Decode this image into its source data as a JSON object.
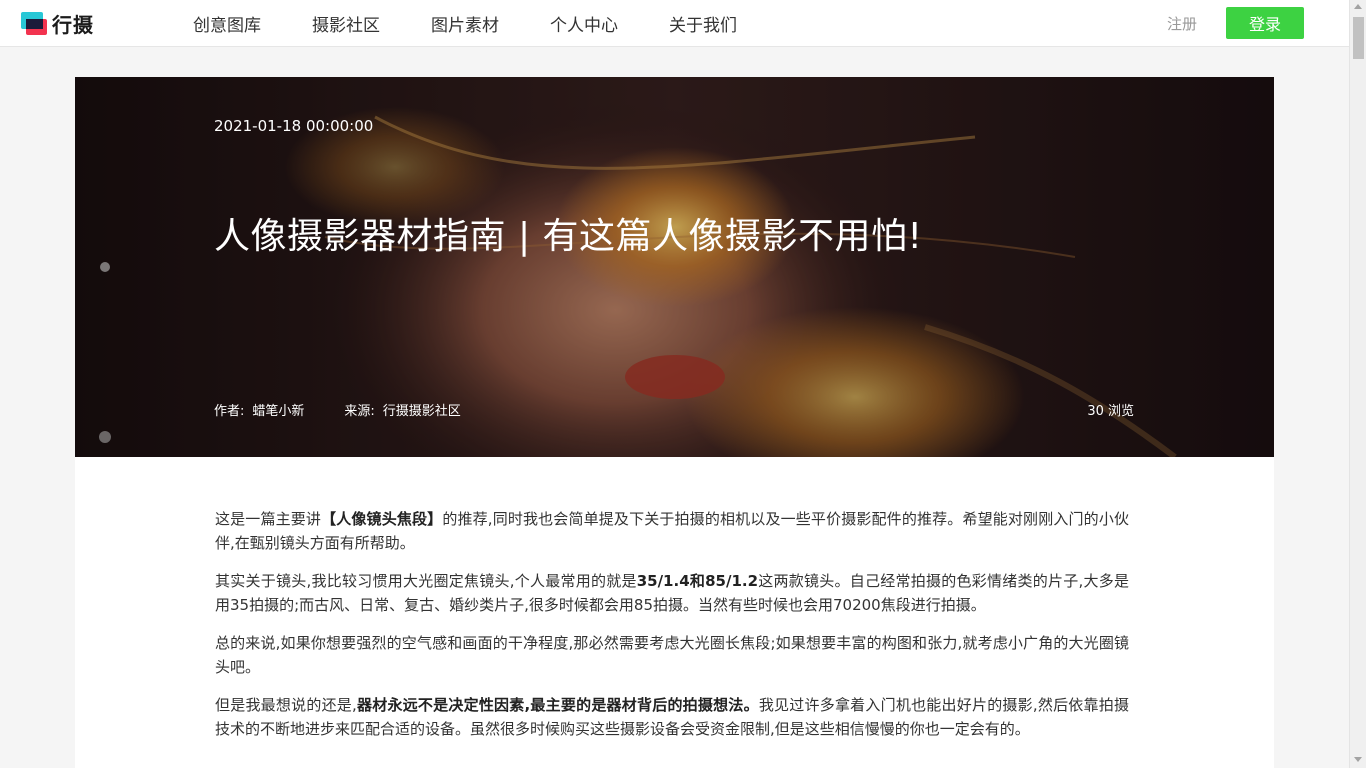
{
  "header": {
    "logo_text": "行摄",
    "nav": [
      "创意图库",
      "摄影社区",
      "图片素材",
      "个人中心",
      "关于我们"
    ],
    "register_label": "注册",
    "login_label": "登录",
    "accent_color": "#3dd242"
  },
  "hero": {
    "date": "2021-01-18 00:00:00",
    "title": "人像摄影器材指南 | 有这篇人像摄影不用怕!",
    "author_label": "作者:",
    "author": "蜡笔小新",
    "source_label": "来源:",
    "source": "行摄摄影社区",
    "views": "30 浏览"
  },
  "article": {
    "p1": {
      "a": "这是一篇主要讲",
      "b": "【人像镜头焦段】",
      "c": "的推荐,同时我也会简单提及下关于拍摄的相机以及一些平价摄影配件的推荐。希望能对刚刚入门的小伙伴,在甄别镜头方面有所帮助。"
    },
    "p2": {
      "a": "其实关于镜头,我比较习惯用大光圈定焦镜头,个人最常用的就是",
      "b": "35/1.4和85/1.2",
      "c": "这两款镜头。自己经常拍摄的色彩情绪类的片子,大多是用35拍摄的;而古风、日常、复古、婚纱类片子,很多时候都会用85拍摄。当然有些时候也会用70200焦段进行拍摄。"
    },
    "p3": "总的来说,如果你想要强烈的空气感和画面的干净程度,那必然需要考虑大光圈长焦段;如果想要丰富的构图和张力,就考虑小广角的大光圈镜头吧。",
    "p4": {
      "a": "但是我最想说的还是,",
      "b": "器材永远不是决定性因素,最主要的是器材背后的拍摄想法。",
      "c": "我见过许多拿着入门机也能出好片的摄影,然后依靠拍摄技术的不断地进步来匹配合适的设备。虽然很多时候购买这些摄影设备会受资金限制,但是这些相信慢慢的你也一定会有的。"
    }
  }
}
